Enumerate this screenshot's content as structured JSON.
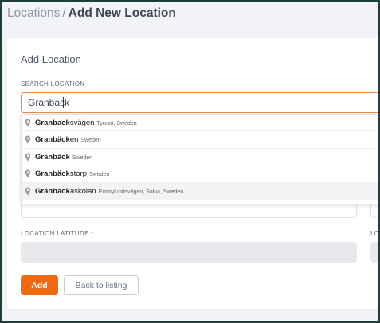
{
  "breadcrumb": {
    "parent": "Locations",
    "separator": "/",
    "current": "Add New Location"
  },
  "card": {
    "title": "Add Location"
  },
  "search": {
    "label": "SEARCH LOCATION",
    "value": "Granback"
  },
  "suggestions": [
    {
      "match": "Granback",
      "rest": "svägen",
      "secondary": "Tyresö, Sweden"
    },
    {
      "match": "Granbäck",
      "rest": "en",
      "secondary": "Sweden"
    },
    {
      "match": "Granbäck",
      "rest": "",
      "secondary": "Sweden"
    },
    {
      "match": "Granbäck",
      "rest": "storp",
      "secondary": "Sweden"
    },
    {
      "match": "Granback",
      "rest": "askolan",
      "secondary": "Emmylundsvägen, Solna, Sweden"
    }
  ],
  "latitude": {
    "label": "LOCATION LATITUDE *"
  },
  "longitude": {
    "label": "LO"
  },
  "actions": {
    "add_label": "Add",
    "back_label": "Back to listing"
  },
  "colors": {
    "accent": "#f06a10",
    "focus_border": "#f08a3c"
  }
}
